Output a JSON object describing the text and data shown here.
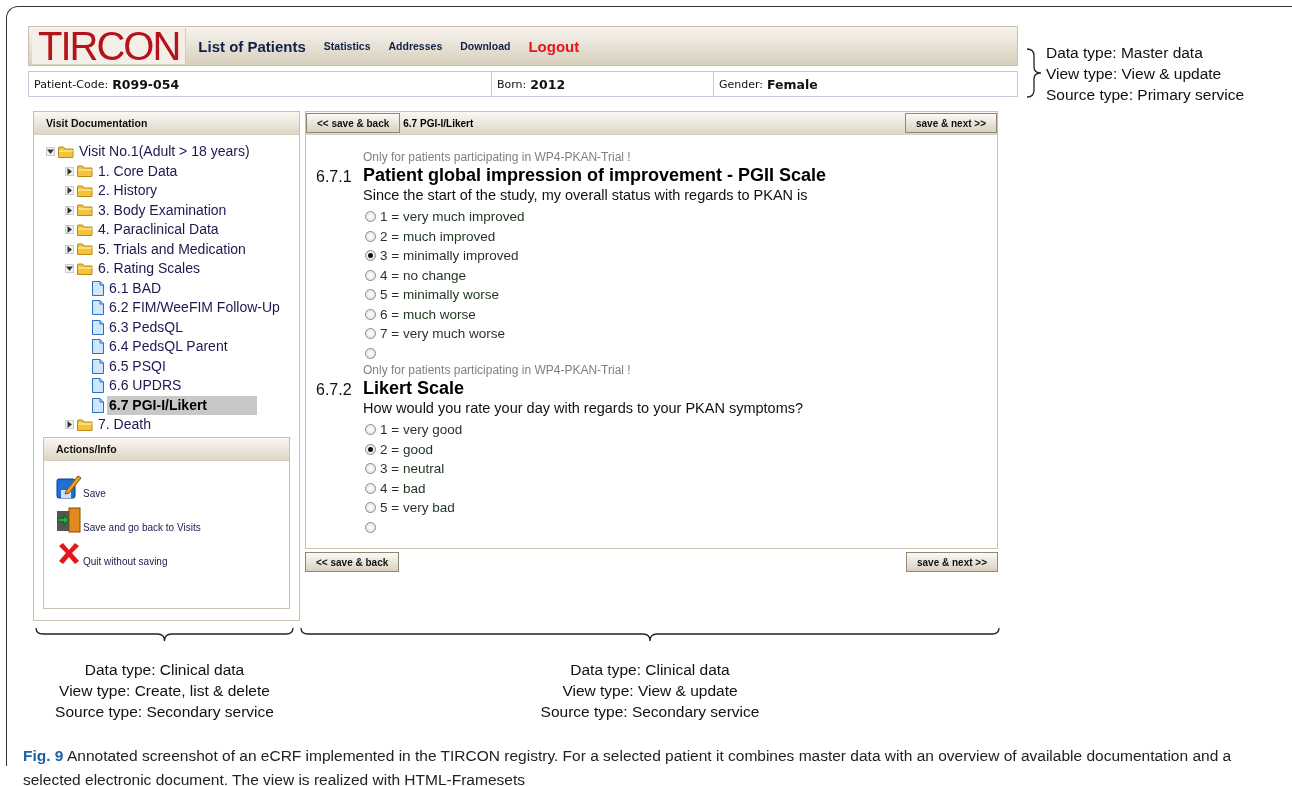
{
  "header": {
    "logo": "TIRCON",
    "nav": [
      {
        "label": "List of Patients",
        "kind": "main"
      },
      {
        "label": "Statistics",
        "kind": "sub"
      },
      {
        "label": "Addresses",
        "kind": "sub"
      },
      {
        "label": "Download",
        "kind": "sub"
      },
      {
        "label": "Logout",
        "kind": "logout"
      }
    ]
  },
  "patient_bar": [
    {
      "label": "Patient-Code:",
      "value": "R099-054"
    },
    {
      "label": "Born:",
      "value": "2012"
    },
    {
      "label": "Gender:",
      "value": "Female"
    }
  ],
  "sidebar": {
    "title": "Visit Documentation",
    "tree": [
      {
        "label": "Visit No.1(Adult > 18 years)",
        "kind": "folder",
        "expanded": true,
        "selected": false,
        "children": [
          {
            "label": "1. Core Data",
            "kind": "folder",
            "expanded": false,
            "selected": false
          },
          {
            "label": "2. History",
            "kind": "folder",
            "expanded": false,
            "selected": false
          },
          {
            "label": "3. Body Examination",
            "kind": "folder",
            "expanded": false,
            "selected": false
          },
          {
            "label": "4. Paraclinical Data",
            "kind": "folder",
            "expanded": false,
            "selected": false
          },
          {
            "label": "5. Trials and Medication",
            "kind": "folder",
            "expanded": false,
            "selected": false
          },
          {
            "label": "6. Rating Scales",
            "kind": "folder",
            "expanded": true,
            "selected": false,
            "children": [
              {
                "label": "6.1 BAD",
                "kind": "document",
                "selected": false
              },
              {
                "label": "6.2 FIM/WeeFIM Follow-Up",
                "kind": "document",
                "selected": false
              },
              {
                "label": "6.3 PedsQL",
                "kind": "document",
                "selected": false
              },
              {
                "label": "6.4 PedsQL Parent",
                "kind": "document",
                "selected": false
              },
              {
                "label": "6.5 PSQI",
                "kind": "document",
                "selected": false
              },
              {
                "label": "6.6 UPDRS",
                "kind": "document",
                "selected": false
              },
              {
                "label": "6.7 PGI-I/Likert",
                "kind": "document",
                "selected": true
              }
            ]
          },
          {
            "label": "7. Death",
            "kind": "folder",
            "expanded": false,
            "selected": false
          }
        ]
      }
    ]
  },
  "actions": {
    "title": "Actions/Info",
    "items": [
      {
        "label": "Save",
        "kind": "save"
      },
      {
        "label": "Save and go back to Visits",
        "kind": "exit"
      },
      {
        "label": "Quit without saving",
        "kind": "quit"
      }
    ]
  },
  "form": {
    "back_button": "<< save & back",
    "title": "6.7 PGI-I/Likert",
    "next_button": "save & next >>",
    "questions": [
      {
        "note": "Only for patients participating in WP4-PKAN-Trial !",
        "number": "6.7.1",
        "title": "Patient global impression of improvement - PGII Scale",
        "question": "Since the start of the study, my overall status with regards to PKAN is",
        "options": [
          {
            "label": "1 = very much improved",
            "selected": false
          },
          {
            "label": "2 = much improved",
            "selected": false
          },
          {
            "label": "3 = minimally improved",
            "selected": true
          },
          {
            "label": "4 = no change",
            "selected": false
          },
          {
            "label": "5 = minimally worse",
            "selected": false
          },
          {
            "label": "6 = much worse",
            "selected": false
          },
          {
            "label": "7 = very much worse",
            "selected": false
          },
          {
            "selected": false
          }
        ]
      },
      {
        "note": "Only for patients participating in WP4-PKAN-Trial !",
        "number": "6.7.2",
        "title": "Likert Scale",
        "question": "How would you rate your day with regards to your PKAN symptoms?",
        "options": [
          {
            "label": "1 = very good",
            "selected": false
          },
          {
            "label": "2 = good",
            "selected": true
          },
          {
            "label": "3 = neutral",
            "selected": false
          },
          {
            "label": "4 = bad",
            "selected": false
          },
          {
            "label": "5 = very bad",
            "selected": false
          },
          {
            "selected": false
          }
        ]
      }
    ],
    "bottom_back_button": "<< save & back",
    "bottom_next_button": "save & next >>"
  },
  "annotations": {
    "header": [
      "Data type: Master data",
      "View type: View & update",
      "Source type: Primary service"
    ],
    "sidebar": [
      "Data type: Clinical data",
      "View type: Create, list & delete",
      "Source type: Secondary  service"
    ],
    "form": [
      "Data type: Clinical data",
      "View type: View & update",
      "Source type: Secondary  service"
    ]
  },
  "caption": "**Fig. 9** Annotated screenshot of an eCRF implemented in the TIRCON registry. For a selected patient it combines master data with an overview of available documentation and a selected electronic document. The view is realized with HTML-Framesets"
}
